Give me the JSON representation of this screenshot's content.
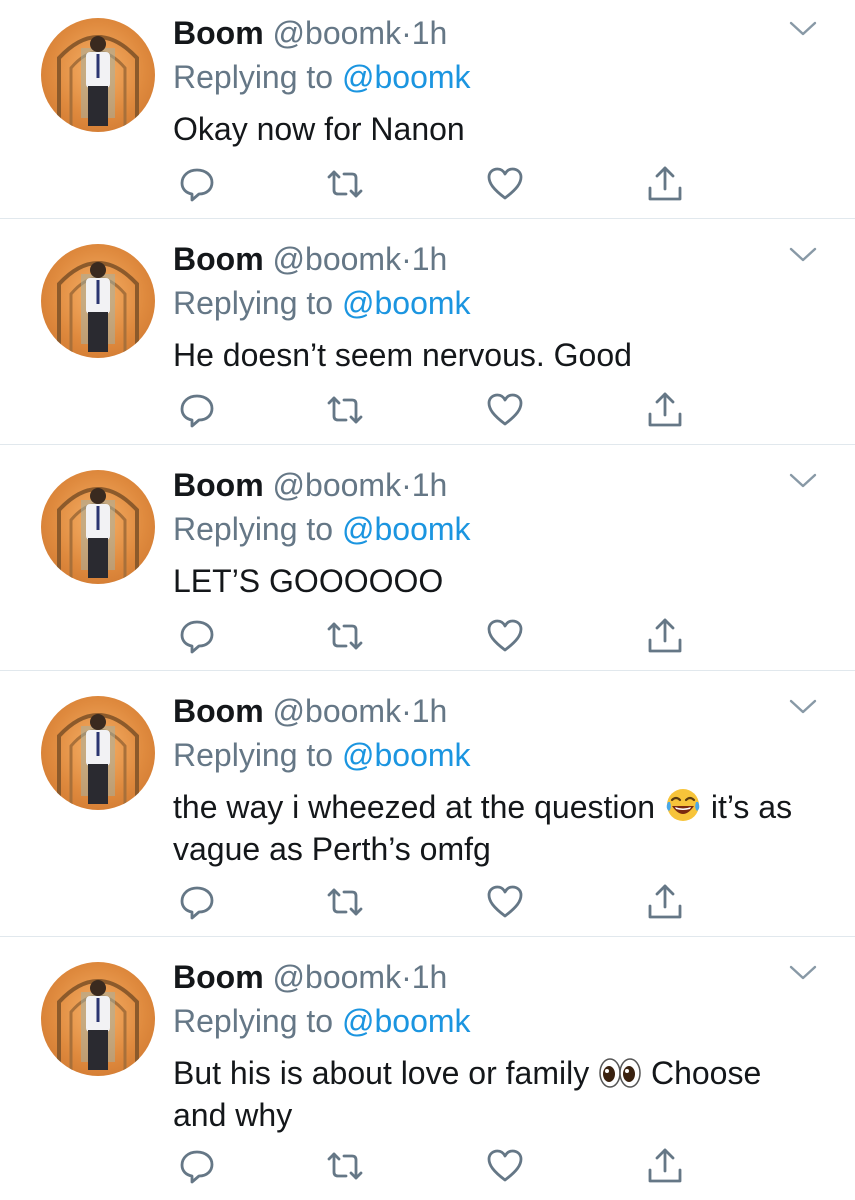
{
  "tweets": [
    {
      "name": "Boom",
      "handle": "@boomk",
      "dot": "·",
      "time": "1h",
      "reply_prefix": "Replying to ",
      "reply_to": "@boomk",
      "text": "Okay now for Nanon"
    },
    {
      "name": "Boom",
      "handle": "@boomk",
      "dot": "·",
      "time": "1h",
      "reply_prefix": "Replying to ",
      "reply_to": "@boomk",
      "text": "He doesn’t seem nervous. Good"
    },
    {
      "name": "Boom",
      "handle": "@boomk",
      "dot": "·",
      "time": "1h",
      "reply_prefix": "Replying to ",
      "reply_to": "@boomk",
      "text": "LET’S GOOOOOO"
    },
    {
      "name": "Boom",
      "handle": "@boomk",
      "dot": "·",
      "time": "1h",
      "reply_prefix": "Replying to ",
      "reply_to": "@boomk",
      "text_before": "the way i wheezed at the question ",
      "emoji": "face-with-tears-of-joy-emoji",
      "text_after": " it’s as vague as Perth’s omfg"
    },
    {
      "name": "Boom",
      "handle": "@boomk",
      "dot": "·",
      "time": "1h",
      "reply_prefix": "Replying to ",
      "reply_to": "@boomk",
      "text_before": "But his is about love or family ",
      "emoji": "eyes-emoji",
      "text_after": " Choose and why"
    }
  ],
  "icons": {
    "reply": "speech-bubble-icon",
    "retweet": "retweet-icon",
    "like": "heart-icon",
    "share": "share-icon",
    "menu": "chevron-down-icon"
  },
  "colors": {
    "text": "#14171a",
    "secondary": "#657786",
    "link": "#1b95e0",
    "divider": "#e1e8ed"
  }
}
